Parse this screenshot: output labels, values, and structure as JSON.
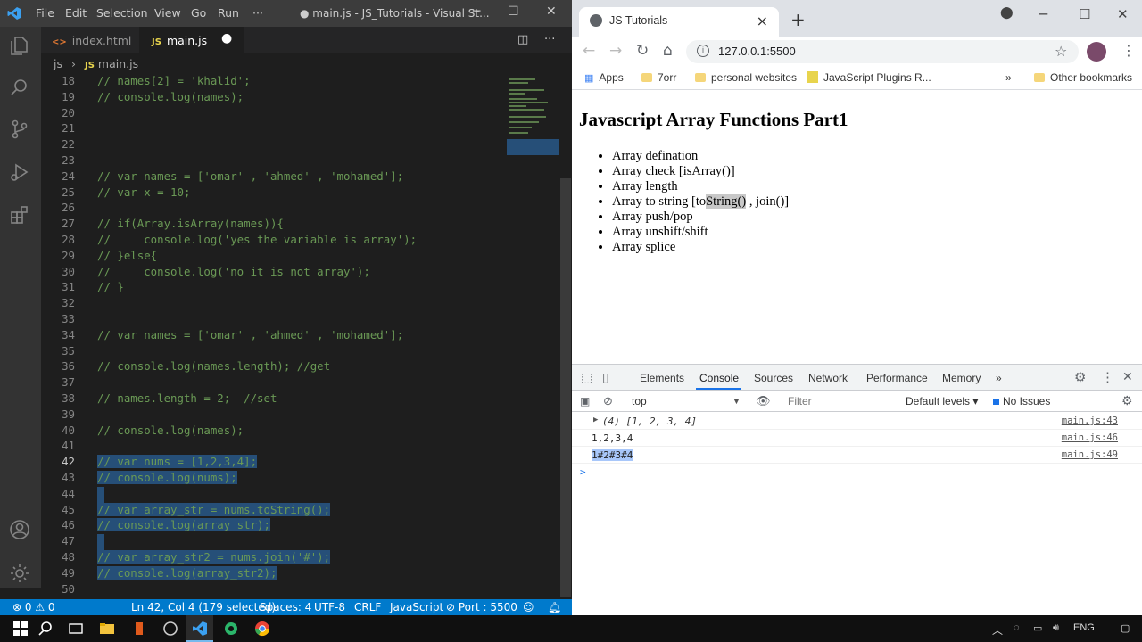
{
  "vscode": {
    "menu": [
      "File",
      "Edit",
      "Selection",
      "View",
      "Go",
      "Run",
      "···"
    ],
    "window_title": "● main.js - JS_Tutorials - Visual St...",
    "tabs": [
      {
        "icon": "<>",
        "label": "index.html"
      },
      {
        "icon": "JS",
        "label": "main.js"
      }
    ],
    "breadcrumb": {
      "folder": "js",
      "icon": "JS",
      "file": "main.js"
    },
    "lines": [
      {
        "n": "18",
        "text": "// names[2] = 'khalid';"
      },
      {
        "n": "19",
        "text": "// console.log(names);"
      },
      {
        "n": "20",
        "text": ""
      },
      {
        "n": "21",
        "text": ""
      },
      {
        "n": "22",
        "text": ""
      },
      {
        "n": "23",
        "text": ""
      },
      {
        "n": "24",
        "text": "// var names = ['omar' , 'ahmed' , 'mohamed'];"
      },
      {
        "n": "25",
        "text": "// var x = 10;"
      },
      {
        "n": "26",
        "text": ""
      },
      {
        "n": "27",
        "text": "// if(Array.isArray(names)){"
      },
      {
        "n": "28",
        "text": "//     console.log('yes the variable is array');"
      },
      {
        "n": "29",
        "text": "// }else{"
      },
      {
        "n": "30",
        "text": "//     console.log('no it is not array');"
      },
      {
        "n": "31",
        "text": "// }"
      },
      {
        "n": "32",
        "text": ""
      },
      {
        "n": "33",
        "text": ""
      },
      {
        "n": "34",
        "text": "// var names = ['omar' , 'ahmed' , 'mohamed'];"
      },
      {
        "n": "35",
        "text": ""
      },
      {
        "n": "36",
        "text": "// console.log(names.length); //get"
      },
      {
        "n": "37",
        "text": ""
      },
      {
        "n": "38",
        "text": "// names.length = 2;  //set"
      },
      {
        "n": "39",
        "text": ""
      },
      {
        "n": "40",
        "text": "// console.log(names);"
      },
      {
        "n": "41",
        "text": ""
      },
      {
        "n": "42",
        "text": "// var nums = [1,2,3,4];"
      },
      {
        "n": "43",
        "text": "// console.log(nums);"
      },
      {
        "n": "44",
        "text": ""
      },
      {
        "n": "45",
        "text": "// var array_str = nums.toString();"
      },
      {
        "n": "46",
        "text": "// console.log(array_str);"
      },
      {
        "n": "47",
        "text": ""
      },
      {
        "n": "48",
        "text": "// var array_str2 = nums.join('#');"
      },
      {
        "n": "49",
        "text": "// console.log(array_str2);"
      },
      {
        "n": "50",
        "text": ""
      }
    ],
    "status": {
      "problems": "⊗ 0 ⚠ 0",
      "cursor": "Ln 42, Col 4 (179 selected)",
      "spaces": "Spaces: 4",
      "encoding": "UTF-8",
      "eol": "CRLF",
      "language": "JavaScript",
      "port": "⊘ Port : 5500"
    }
  },
  "chrome": {
    "tab_title": "JS Tutorials",
    "url": "127.0.0.1:5500",
    "bookmarks": [
      "Apps",
      "7orr",
      "personal websites",
      "JavaScript Plugins R...",
      "Other bookmarks"
    ],
    "page": {
      "heading": "Javascript Array Functions Part1",
      "items": [
        "Array defination",
        "Array check [isArray()]",
        "Array length",
        "Array to string [toString() , join()]",
        "Array push/pop",
        "Array unshift/shift",
        "Array splice"
      ],
      "item4": {
        "pre": "Array to string [to",
        "hl": "String()",
        "post": " , join()]"
      }
    },
    "devtools": {
      "tabs": [
        "Elements",
        "Console",
        "Sources",
        "Network",
        "Performance",
        "Memory",
        "»"
      ],
      "context": "top",
      "filter_placeholder": "Filter",
      "levels": "Default levels ▾",
      "issues": "No Issues",
      "messages": [
        {
          "text": "(4) [1, 2, 3, 4]",
          "src": "main.js:43"
        },
        {
          "text": "1,2,3,4",
          "src": "main.js:46"
        },
        {
          "text": "1#2#3#4",
          "src": "main.js:49"
        }
      ],
      "prompt": ">"
    }
  },
  "taskbar": {
    "lang": "ENG"
  },
  "colors": {
    "vscode_bg": "#1e1e1e",
    "comment": "#6a9955",
    "selection": "#264f78",
    "statusbar": "#007acc",
    "chrome_tab_strip": "#dee1e6"
  }
}
